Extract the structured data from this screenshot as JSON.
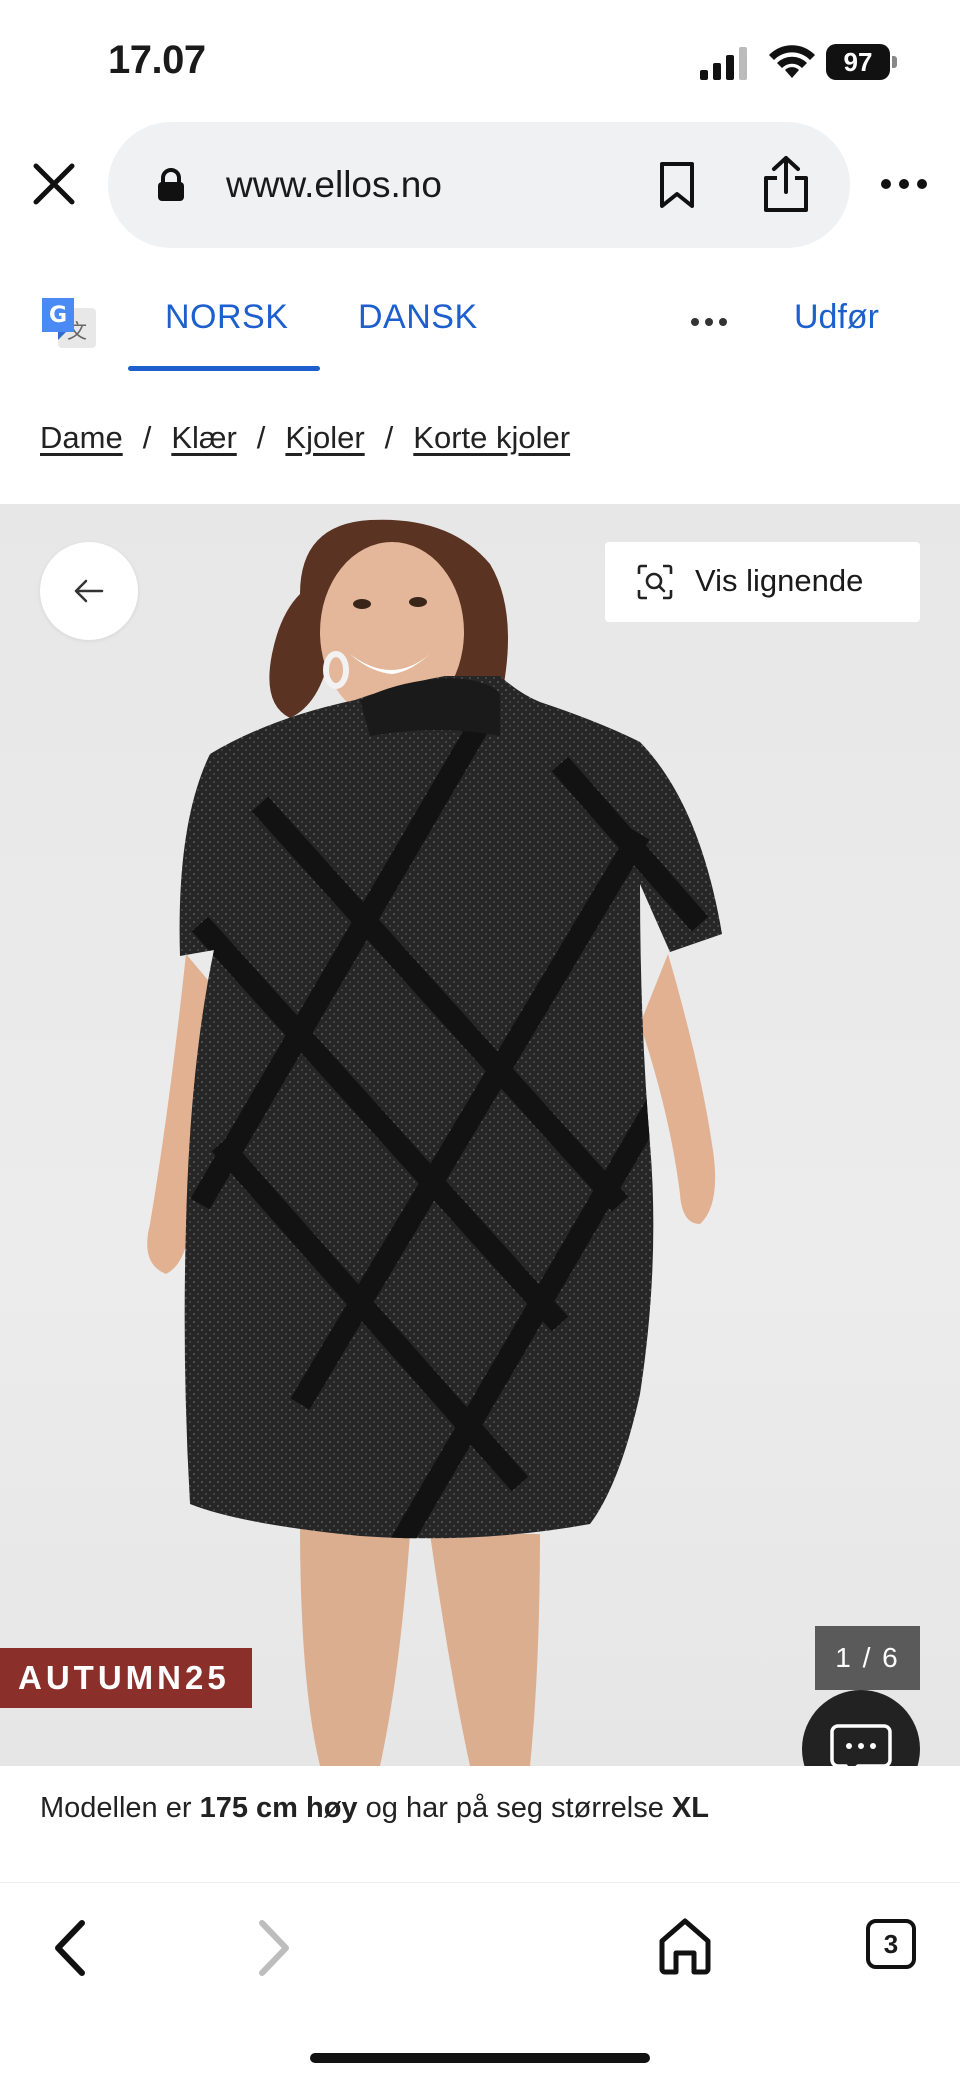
{
  "status": {
    "time": "17.07",
    "battery": "97"
  },
  "browser": {
    "url": "www.ellos.no",
    "tab_count": "3"
  },
  "translate": {
    "tabs": [
      {
        "label": "NORSK",
        "active": true
      },
      {
        "label": "DANSK",
        "active": false
      }
    ],
    "done_label": "Udfør"
  },
  "breadcrumb": {
    "items": [
      "Dame",
      "Klær",
      "Kjoler",
      "Korte kjoler"
    ],
    "separator": "/"
  },
  "product": {
    "similar_button": "Vis lignende",
    "promo_badge": "AUTUMN25",
    "image_counter": "1 / 6"
  },
  "model_info": {
    "prefix": "Modellen er ",
    "height": "175 cm høy",
    "middle": " og har på seg størrelse ",
    "size": "XL"
  },
  "colors": {
    "link_blue": "#1d5fcc",
    "promo_red": "#8b2f2a",
    "dress_black": "#1c1c1c",
    "image_bg": "#e9e9e9"
  }
}
